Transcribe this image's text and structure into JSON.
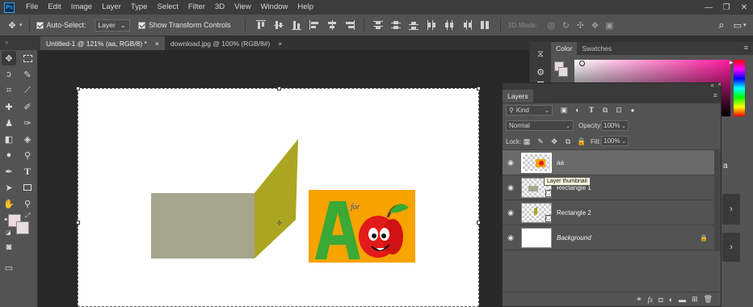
{
  "app": {
    "logo": "Ps"
  },
  "menu": [
    "File",
    "Edit",
    "Image",
    "Layer",
    "Type",
    "Select",
    "Filter",
    "3D",
    "View",
    "Window",
    "Help"
  ],
  "window_controls": [
    "—",
    "❐",
    "✕"
  ],
  "options": {
    "auto_select_label": "Auto-Select:",
    "auto_select_value": "Layer",
    "show_transform_label": "Show Transform Controls",
    "mode_3d_label": "3D Mode:"
  },
  "tabs": [
    {
      "label": "Untitled-1 @ 121% (aa, RGB/8) *",
      "close": "×"
    },
    {
      "label": "download.jpg @ 100% (RGB/8#)",
      "close": "×"
    }
  ],
  "panels": {
    "color_tab": "Color",
    "swatches_tab": "Swatches",
    "layers_title": "Layers",
    "filter_kind": "Kind",
    "blend_mode": "Normal",
    "opacity_label": "Opacity:",
    "opacity_value": "100%",
    "lock_label": "Lock:",
    "fill_label": "Fill:",
    "fill_value": "100%",
    "tooltip": "Layer thumbnail",
    "dock_letter": "a"
  },
  "layers": [
    {
      "name": "aa",
      "selected": true
    },
    {
      "name": "Rectangle 1",
      "selected": false
    },
    {
      "name": "Rectangle 2",
      "selected": false
    },
    {
      "name": "Background",
      "selected": false,
      "locked": true
    }
  ],
  "artwork": {
    "letter": "A",
    "small_text": "for",
    "rect_color": "#a5a58e",
    "parallelogram_color": "#aba621",
    "image_bg": "#f7a300"
  },
  "colors": {
    "foreground": "#ecd8df",
    "background": "#e6dde0",
    "picker_hue": "#ff1aa0"
  }
}
